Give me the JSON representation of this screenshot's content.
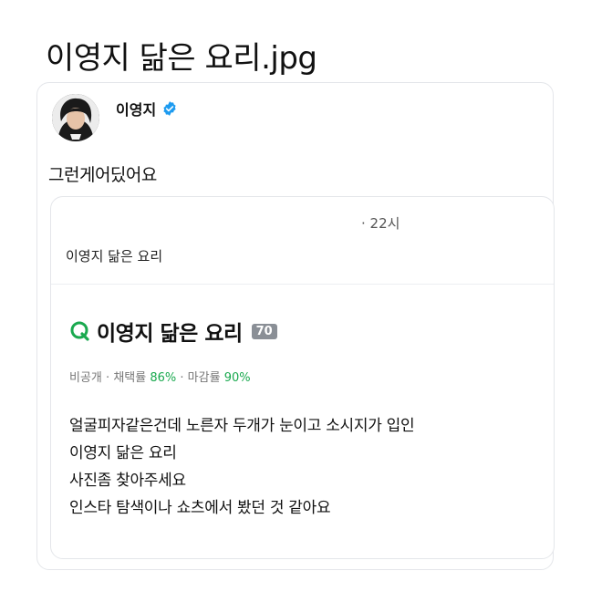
{
  "page": {
    "title": "이영지 닮은 요리.jpg"
  },
  "tweet": {
    "author": "이영지",
    "text": "그런게어딨어요"
  },
  "quote": {
    "time": "· 22시",
    "heading": "이영지 닮은 요리",
    "question": {
      "title": "이영지 닮은 요리",
      "badge": "70",
      "stats": {
        "visibility": "비공개",
        "adopt_label": "채택률",
        "adopt_value": "86%",
        "close_label": "마감률",
        "close_value": "90%",
        "separator": "·"
      },
      "body_lines": [
        "얼굴피자같은건데 노른자 두개가 눈이고 소시지가 입인",
        "이영지 닮은 요리",
        "사진좀 찾아주세요",
        "인스타 탐색이나 쇼츠에서 봤던 것 같아요"
      ]
    }
  },
  "colors": {
    "accent_green": "#1aa94f",
    "verified_blue": "#1d9bf0",
    "badge_gray": "#8a8f96"
  },
  "icons": {
    "verified": "verified-badge-icon",
    "logo": "q-logo-icon"
  }
}
